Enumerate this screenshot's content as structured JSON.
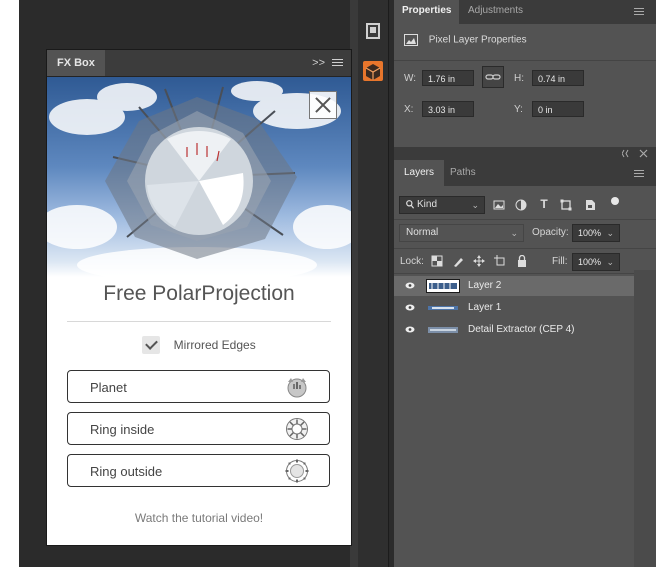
{
  "fx_box": {
    "tab_label": "FX Box",
    "collapse_glyph": ">>",
    "title": "Free PolarProjection",
    "checkbox_label": "Mirrored Edges",
    "buttons": [
      {
        "label": "Planet",
        "icon": "planet-icon"
      },
      {
        "label": "Ring inside",
        "icon": "ring-inside-icon"
      },
      {
        "label": "Ring outside",
        "icon": "ring-outside-icon"
      }
    ],
    "tutorial_link": "Watch the tutorial video!"
  },
  "properties": {
    "tabs": [
      "Properties",
      "Adjustments"
    ],
    "subtitle": "Pixel Layer Properties",
    "fields": {
      "w_label": "W:",
      "w_value": "1.76 in",
      "h_label": "H:",
      "h_value": "0.74 in",
      "x_label": "X:",
      "x_value": "3.03 in",
      "y_label": "Y:",
      "y_value": "0 in"
    }
  },
  "layers": {
    "tabs": [
      "Layers",
      "Paths"
    ],
    "kind_filter": "Kind",
    "blend_mode": "Normal",
    "opacity_label": "Opacity:",
    "opacity_value": "100%",
    "lock_label": "Lock:",
    "fill_label": "Fill:",
    "fill_value": "100%",
    "items": [
      {
        "name": "Layer 2",
        "selected": true
      },
      {
        "name": "Layer 1",
        "selected": false
      },
      {
        "name": "Detail Extractor  (CEP 4)",
        "selected": false
      }
    ]
  },
  "colors": {
    "workspace_bg": "#2b2b2b",
    "panel_bg": "#535353",
    "panel_header": "#3b3b3b",
    "selected_layer": "#6a6a6a",
    "plugin_accent": "#e8762c"
  }
}
